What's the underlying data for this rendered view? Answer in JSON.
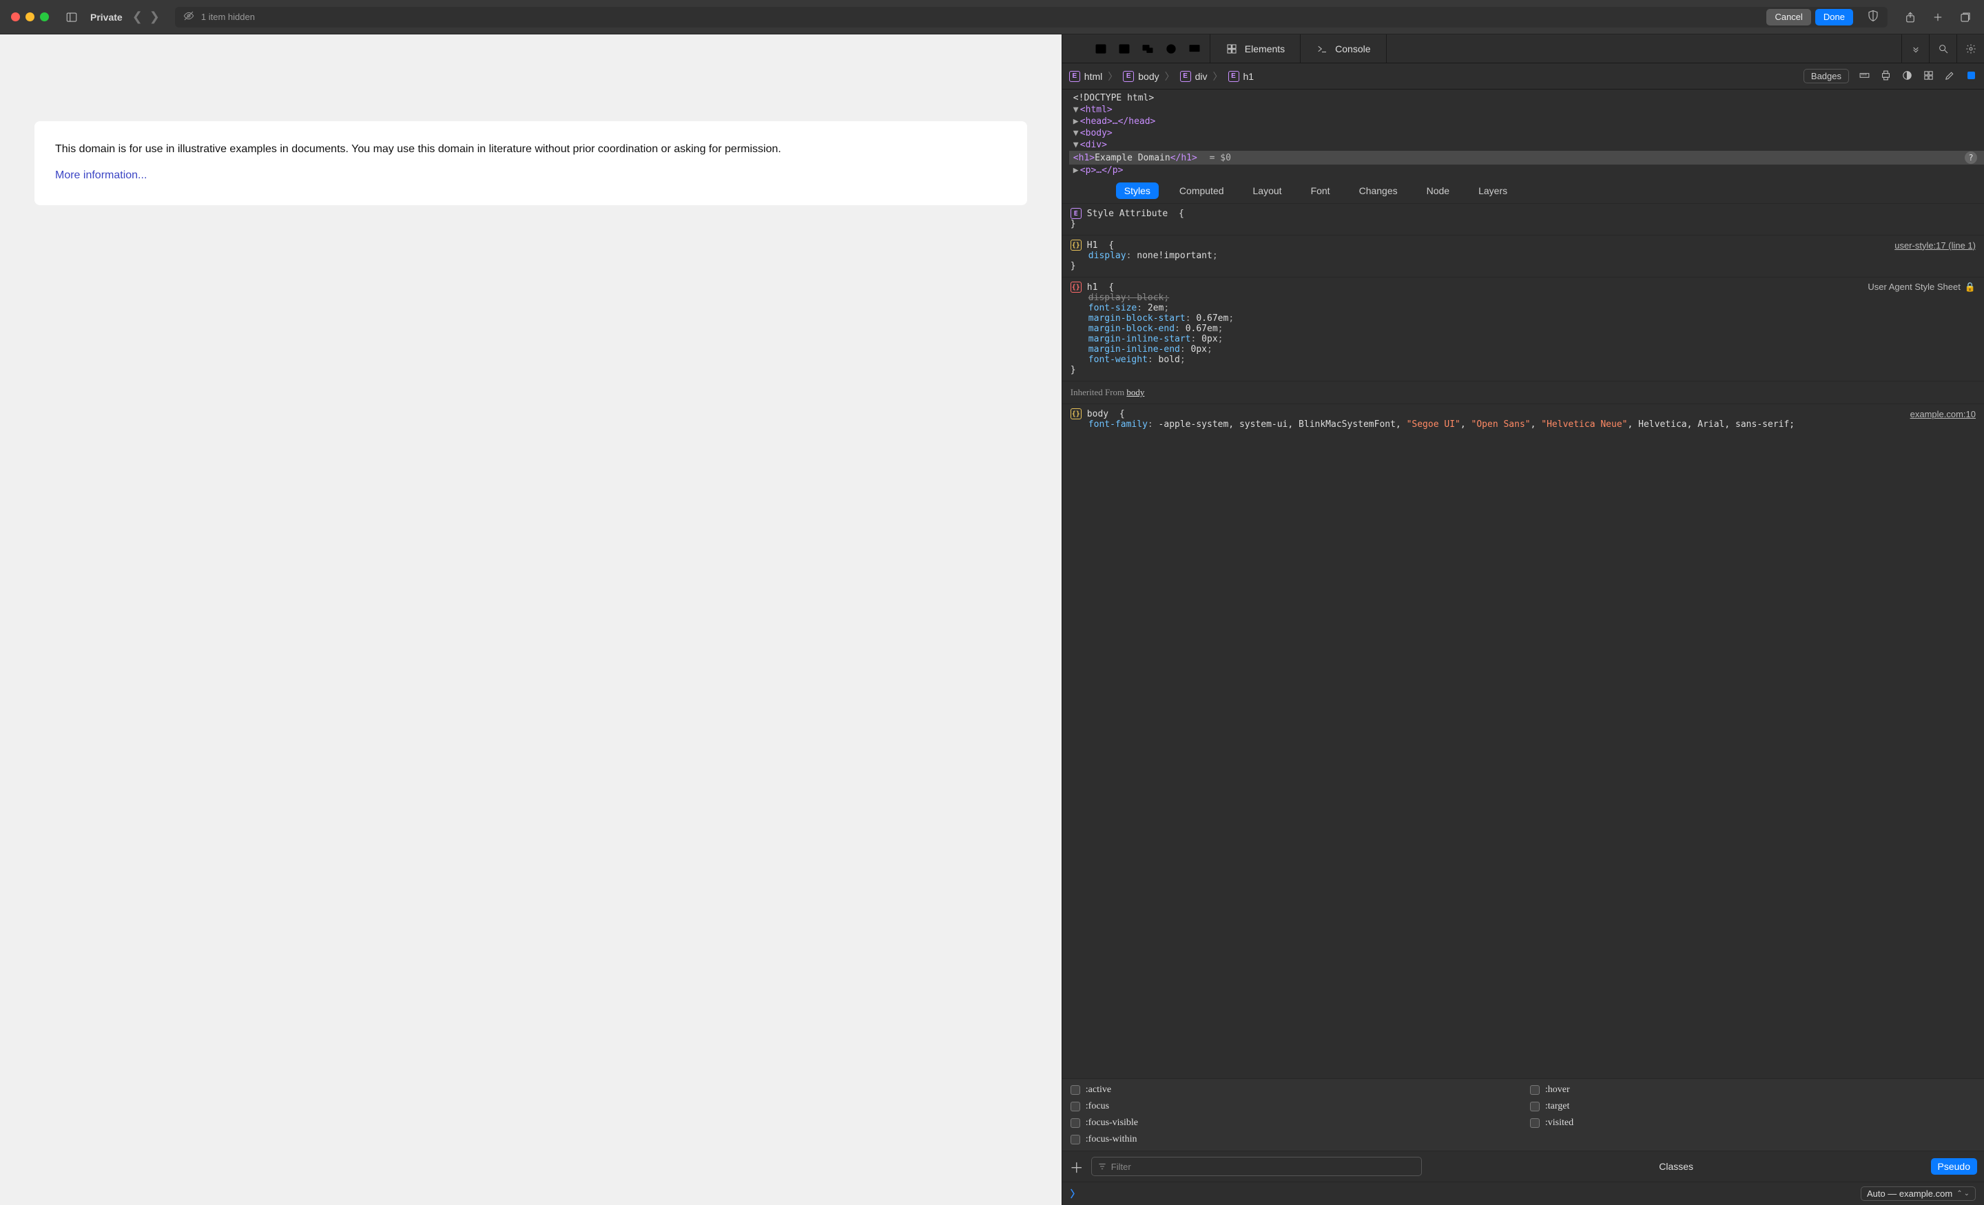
{
  "toolbar": {
    "private_label": "Private",
    "hidden_label": "1 item hidden",
    "cancel": "Cancel",
    "done": "Done"
  },
  "page": {
    "paragraph": "This domain is for use in illustrative examples in documents. You may use this domain in literature without prior coordination or asking for permission.",
    "more_link": "More information..."
  },
  "devtools": {
    "tabs": {
      "elements": "Elements",
      "console": "Console"
    },
    "badges_btn": "Badges",
    "crumbs": [
      "html",
      "body",
      "div",
      "h1"
    ],
    "dom": {
      "doctype": "<!DOCTYPE html>",
      "html_open": "<html>",
      "head": "<head>…</head>",
      "body_open": "<body>",
      "div_open": "<div>",
      "h1_line_open": "<h1>",
      "h1_text": "Example Domain",
      "h1_line_close": "</h1>",
      "eq0": " = $0",
      "p_line": "<p>…</p>"
    },
    "styles_tabs": [
      "Styles",
      "Computed",
      "Layout",
      "Font",
      "Changes",
      "Node",
      "Layers"
    ],
    "styles": {
      "attr_label": "Style Attribute",
      "h1_user": {
        "selector": "H1",
        "decl_prop": "display",
        "decl_val": "none!important",
        "source": "user-style:17 (line 1)"
      },
      "h1_ua": {
        "selector": "h1",
        "source": "User Agent Style Sheet",
        "decls": [
          {
            "prop": "display",
            "val": "block",
            "strike": true
          },
          {
            "prop": "font-size",
            "val": "2em"
          },
          {
            "prop": "margin-block-start",
            "val": "0.67em"
          },
          {
            "prop": "margin-block-end",
            "val": "0.67em"
          },
          {
            "prop": "margin-inline-start",
            "val": "0px"
          },
          {
            "prop": "margin-inline-end",
            "val": "0px"
          },
          {
            "prop": "font-weight",
            "val": "bold"
          }
        ]
      },
      "inherit_label": "Inherited From ",
      "inherit_link": "body",
      "body_rule": {
        "selector": "body",
        "source": "example.com:10",
        "prop": "font-family",
        "val1": "-apple-system, system-ui, BlinkMacSystemFont, ",
        "val_str1": "\"Segoe UI\"",
        "val2": ", ",
        "val_str2": "\"Open Sans\"",
        "val3": ", ",
        "val_str3": "\"Helvetica Neue\"",
        "val4": ", Helvetica, Arial, sans-serif;"
      }
    },
    "pseudo": {
      "active": ":active",
      "hover": ":hover",
      "focus": ":focus",
      "target": ":target",
      "focus_visible": ":focus-visible",
      "visited": ":visited",
      "focus_within": ":focus-within"
    },
    "filter": {
      "placeholder": "Filter",
      "classes": "Classes",
      "pseudo": "Pseudo"
    },
    "console_source": "Auto — example.com"
  }
}
